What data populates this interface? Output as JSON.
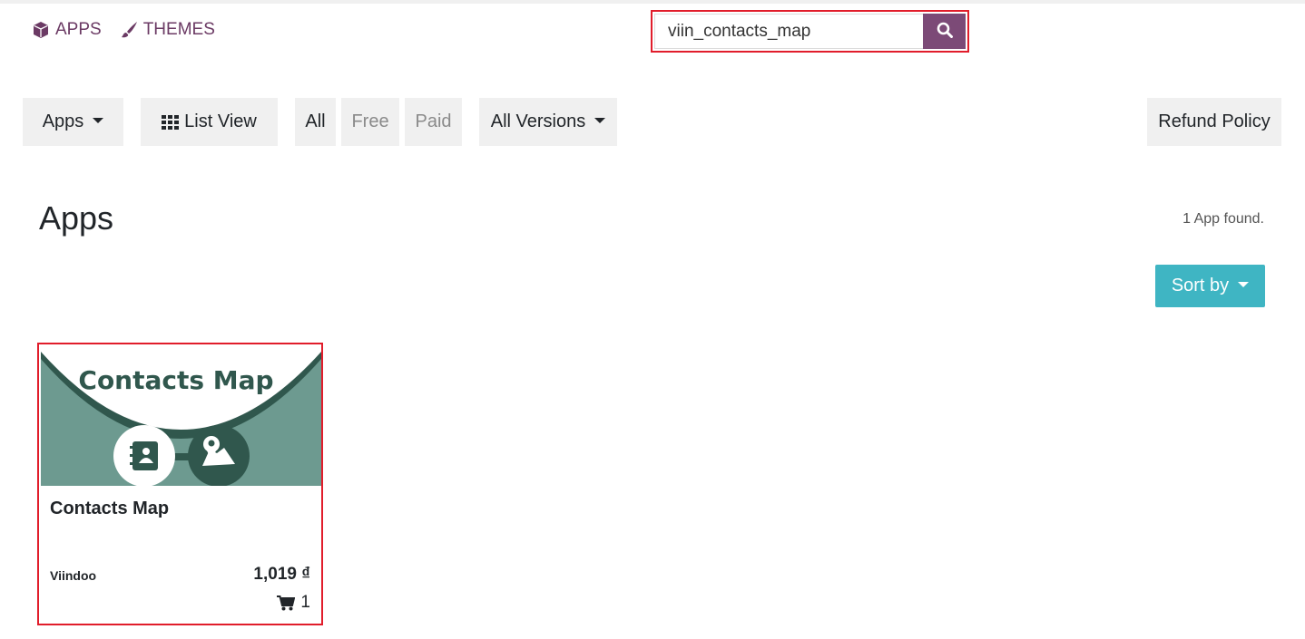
{
  "topnav": {
    "apps_label": "APPS",
    "themes_label": "THEMES"
  },
  "search": {
    "value": "viin_contacts_map"
  },
  "filters": {
    "apps_dropdown": "Apps",
    "list_view": "List View",
    "all": "All",
    "free": "Free",
    "paid": "Paid",
    "versions_dropdown": "All Versions",
    "refund_policy": "Refund Policy"
  },
  "main": {
    "title": "Apps",
    "found_text": "1 App found.",
    "sort_label": "Sort by"
  },
  "card": {
    "banner_title": "Contacts Map",
    "title": "Contacts Map",
    "author": "Viindoo",
    "price": "1,019 ₫",
    "cart_count": "1"
  },
  "colors": {
    "brand_purple": "#7c4a77",
    "nav_purple": "#6b3a64",
    "highlight_red": "#e11d2b",
    "sort_teal": "#3fb5c3",
    "banner_green": "#6d9a90",
    "banner_dark": "#30574d"
  }
}
